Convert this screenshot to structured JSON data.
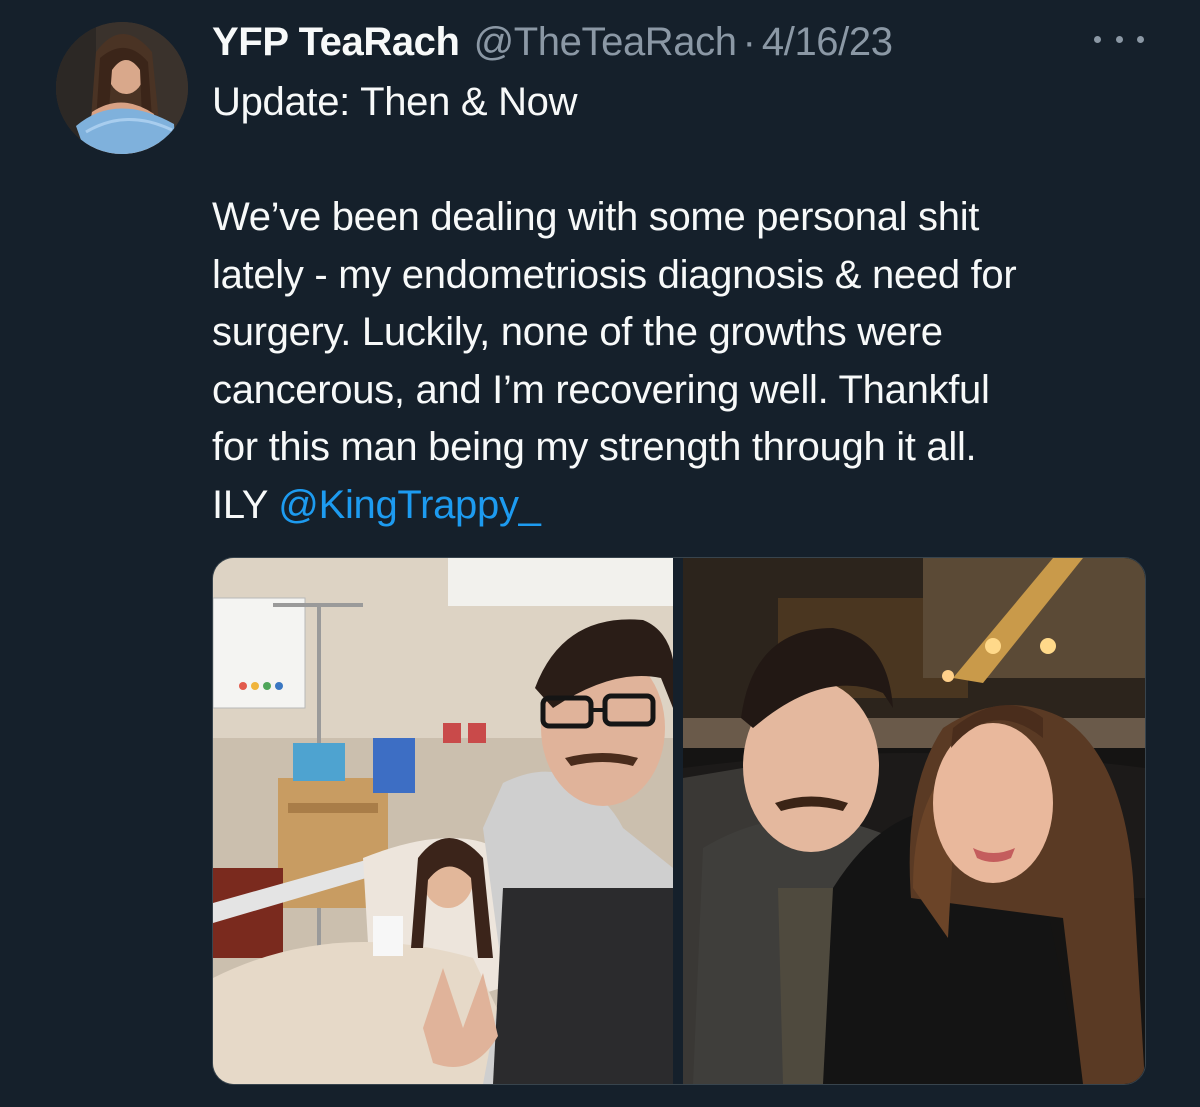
{
  "tweet": {
    "display_name": "YFP TeaRach",
    "handle": "@TheTeaRach",
    "separator": "·",
    "date": "4/16/23",
    "body": {
      "line1": "Update: Then & Now",
      "line2": "We’ve been dealing with some personal shit",
      "line3": "lately - my endometriosis diagnosis & need for",
      "line4": "surgery. Luckily, none of the growths were",
      "line5": "cancerous, and I’m recovering well. Thankful",
      "line6": "for this man being my strength through it all.",
      "line7_prefix": "ILY ",
      "mention": "@KingTrappy_"
    },
    "media": [
      {
        "icon": "hospital-selfie-photo"
      },
      {
        "icon": "restaurant-selfie-photo"
      }
    ]
  },
  "colors": {
    "background": "#15202b",
    "text_primary": "#f7f9f9",
    "text_secondary": "#8b98a5",
    "link": "#1d9bf0"
  }
}
